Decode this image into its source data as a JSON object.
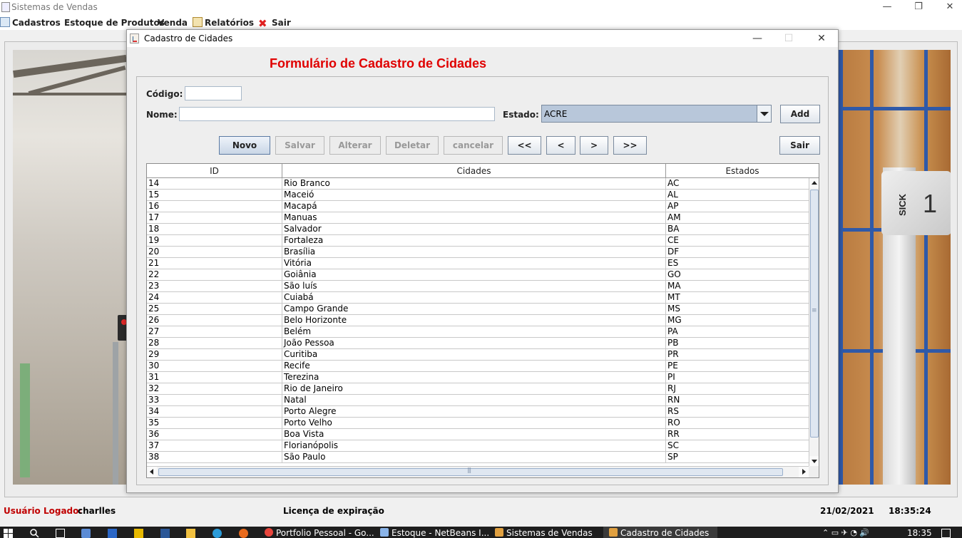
{
  "window": {
    "title": "Sistemas de Vendas",
    "controls": [
      "—",
      "❐",
      "✕"
    ]
  },
  "menubar": {
    "items": [
      {
        "label": "Cadastros",
        "icon": "form-icon"
      },
      {
        "label": "Estoque de Produtos",
        "icon": ""
      },
      {
        "label": "Venda",
        "icon": ""
      },
      {
        "label": "Relatórios",
        "icon": "report-icon"
      },
      {
        "label": "Sair",
        "icon": "red-x-icon"
      }
    ]
  },
  "dialog": {
    "title": "Cadastro de Cidades",
    "controls": [
      "—",
      "☐",
      "✕"
    ],
    "heading": "Formulário de Cadastro de Cidades",
    "form": {
      "codigo_label": "Código:",
      "codigo_value": "",
      "nome_label": "Nome:",
      "nome_value": "",
      "estado_label": "Estado:",
      "estado_value": "ACRE",
      "add_label": "Add"
    },
    "buttons": {
      "novo": "Novo",
      "salvar": "Salvar",
      "alterar": "Alterar",
      "deletar": "Deletar",
      "cancelar": "cancelar",
      "first": "<<",
      "prev": "<",
      "next": ">",
      "last": ">>",
      "sair": "Sair"
    },
    "table": {
      "columns": [
        "ID",
        "Cidades",
        "Estados"
      ],
      "rows": [
        [
          "14",
          "Rio Branco",
          "AC"
        ],
        [
          "15",
          "Maceió",
          "AL"
        ],
        [
          "16",
          "Macapá",
          "AP"
        ],
        [
          "17",
          "Manuas",
          "AM"
        ],
        [
          "18",
          "Salvador",
          "BA"
        ],
        [
          "19",
          "Fortaleza",
          "CE"
        ],
        [
          "20",
          "Brasília",
          "DF"
        ],
        [
          "21",
          "Vitória",
          "ES"
        ],
        [
          "22",
          "Goiânia",
          "GO"
        ],
        [
          "23",
          "São luís",
          "MA"
        ],
        [
          "24",
          "Cuiabá",
          "MT"
        ],
        [
          "25",
          "Campo Grande",
          "MS"
        ],
        [
          "26",
          "Belo Horizonte",
          "MG"
        ],
        [
          "27",
          "Belém",
          "PA"
        ],
        [
          "28",
          "João Pessoa",
          "PB"
        ],
        [
          "29",
          "Curitiba",
          "PR"
        ],
        [
          "30",
          "Recife",
          "PE"
        ],
        [
          "31",
          "Terezina",
          "PI"
        ],
        [
          "32",
          "Rio de Janeiro",
          "RJ"
        ],
        [
          "33",
          "Natal",
          "RN"
        ],
        [
          "34",
          "Porto Alegre",
          "RS"
        ],
        [
          "35",
          "Porto Velho",
          "RO"
        ],
        [
          "36",
          "Boa Vista",
          "RR"
        ],
        [
          "37",
          "Florianópolis",
          "SC"
        ],
        [
          "38",
          "São Paulo",
          "SP"
        ]
      ]
    }
  },
  "statusbar": {
    "user_label": "Usuário Logado:",
    "user_value": "charlles",
    "license_label": "Licença de expiração",
    "date": "21/02/2021",
    "time": "18:35:24"
  },
  "taskbar": {
    "items": [
      {
        "label": "Portfolio Pessoal - Go...",
        "color": "#e8453c"
      },
      {
        "label": "Estoque - NetBeans I...",
        "color": "#8ab4e8"
      },
      {
        "label": "Sistemas de Vendas",
        "color": "#e0a040"
      },
      {
        "label": "Cadastro de Cidades",
        "color": "#e0a040"
      }
    ],
    "clock": "18:35"
  },
  "colors": {
    "heading": "#e00000",
    "status_label": "#c00000",
    "combo_bg": "#b8c7da"
  }
}
